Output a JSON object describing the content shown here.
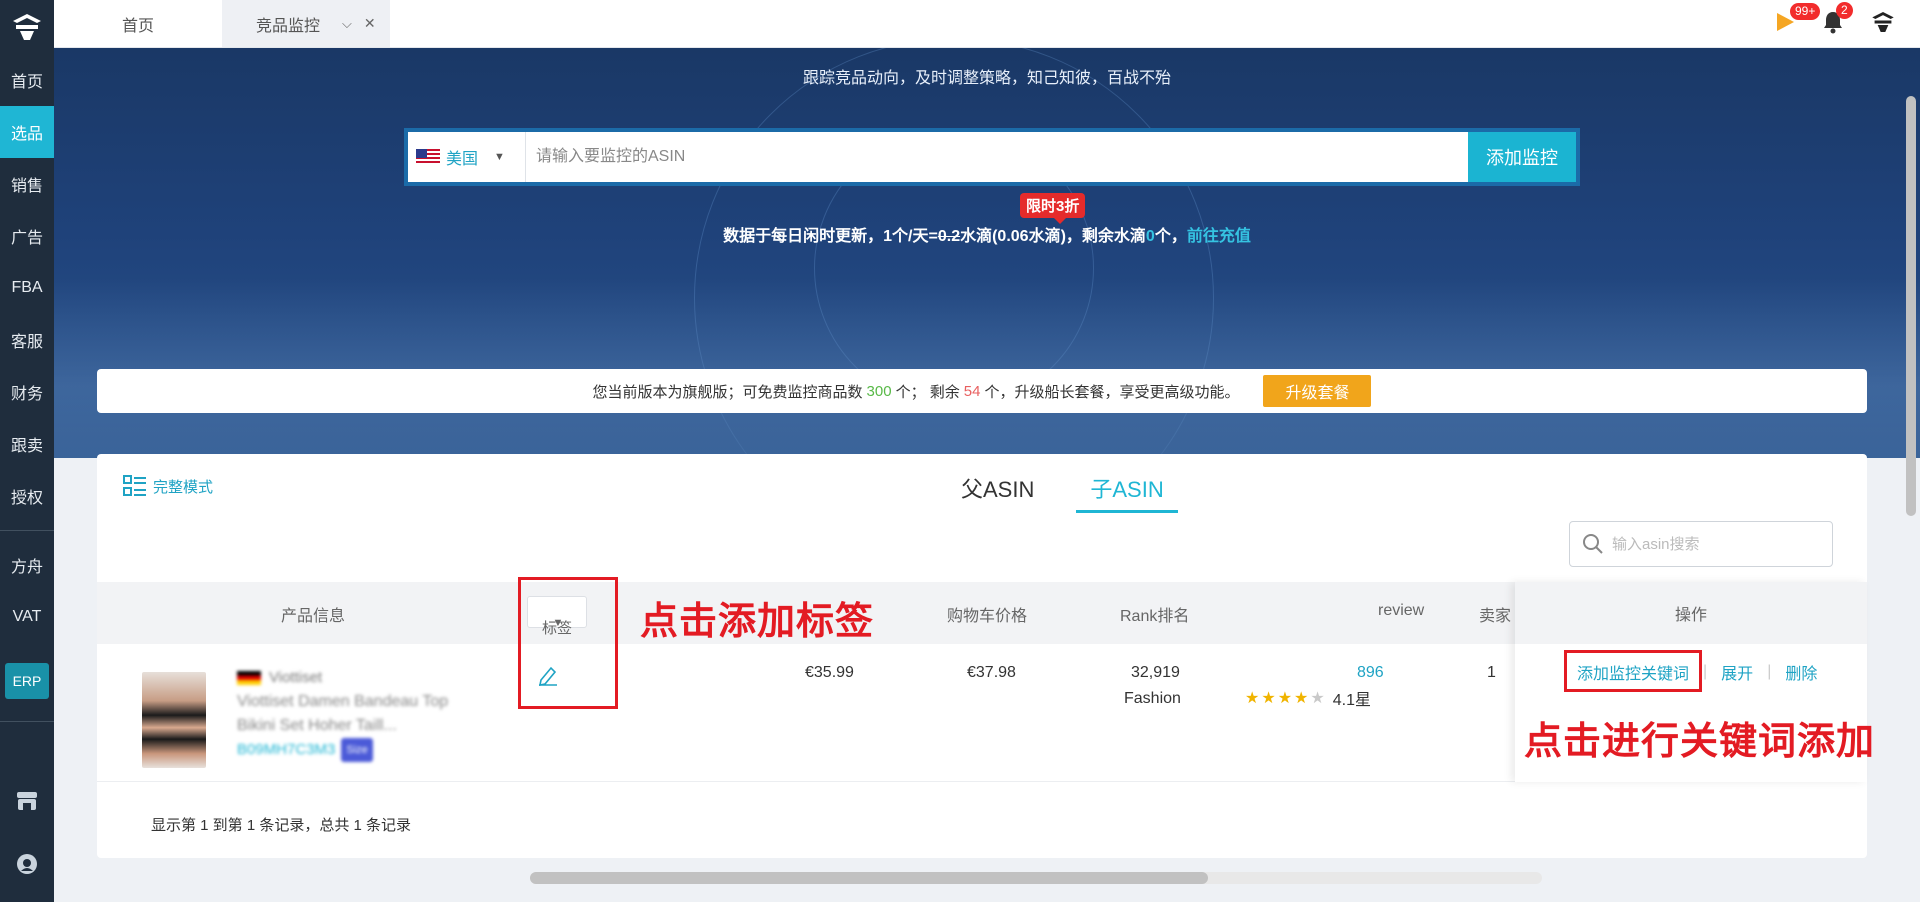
{
  "sidebar": {
    "items": [
      {
        "label": "首页"
      },
      {
        "label": "选品"
      },
      {
        "label": "销售"
      },
      {
        "label": "广告"
      },
      {
        "label": "FBA"
      },
      {
        "label": "客服"
      },
      {
        "label": "财务"
      },
      {
        "label": "跟卖"
      },
      {
        "label": "授权"
      },
      {
        "label": "方舟"
      },
      {
        "label": "VAT"
      }
    ],
    "erp_label": "ERP",
    "active_index": 1
  },
  "topbar": {
    "tabs": [
      {
        "label": "首页"
      },
      {
        "label": "竞品监控"
      }
    ],
    "flag_badge": "99+",
    "bell_badge": "2"
  },
  "hero": {
    "tagline": "跟踪竞品动向，及时调整策略，知己知彼，百战不殆",
    "country": "美国",
    "search_placeholder": "请输入要监控的ASIN",
    "add_button": "添加监控",
    "promo_tag": "限时3折",
    "info": {
      "prefix": "数据于每日闲时更新，1个/天=",
      "old_price": "0.2",
      "mid": "水滴(0.06水滴)，剩余水滴",
      "remaining": "0",
      "suffix": "个，",
      "link": "前往充值"
    }
  },
  "version_bar": {
    "text1": "您当前版本为旗舰版；可免费监控商品数",
    "quota": "300",
    "text2": "个；  剩余",
    "remaining": "54",
    "text3": "个，升级船长套餐，享受更高级功能。",
    "upgrade_button": "升级套餐"
  },
  "main": {
    "full_mode": "完整模式",
    "tabs": [
      {
        "label": "父ASIN"
      },
      {
        "label": "子ASIN"
      }
    ],
    "active_tab": 1,
    "asin_search_placeholder": "输入asin搜索",
    "columns": {
      "product": "产品信息",
      "tag": "标签",
      "cart_price": "购物车价格",
      "rank": "Rank排名",
      "review": "review",
      "seller": "卖家",
      "ops": "操作"
    },
    "rows": [
      {
        "brand": "Viottiset",
        "title": "Viottiset Damen Bandeau Top Bikini Set Hoher Taill...",
        "asin": "B09MH7C3M3",
        "asin_badge": "Size",
        "price": "€35.99",
        "cart_price": "€37.98",
        "rank": "32,919",
        "category": "Fashion",
        "review_count": "896",
        "rating_label": "4.1星",
        "rating": 4.1,
        "seller_partial": "1"
      }
    ],
    "ops_links": [
      "添加监控关键词",
      "展开",
      "删除"
    ],
    "footer": "显示第 1 到第 1 条记录，总共 1 条记录"
  },
  "annotations": {
    "tag_hint": "点击添加标签",
    "keyword_hint": "点击进行关键词添加"
  },
  "colors": {
    "accent": "#1fb6d4",
    "sidebar": "#1f2d3d",
    "upgrade": "#f1a51b",
    "annotation": "#e31b23"
  }
}
